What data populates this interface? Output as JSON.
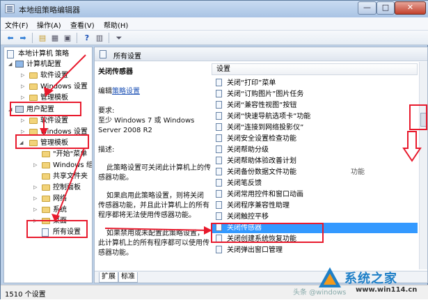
{
  "window": {
    "title": "本地组策略编辑器",
    "min_label": "—",
    "max_label": "□",
    "close_label": "✕"
  },
  "menubar": {
    "items": [
      "文件(F)",
      "操作(A)",
      "查看(V)",
      "帮助(H)"
    ]
  },
  "toolbar": {
    "icons": [
      "back-icon",
      "forward-icon",
      "up-folder-icon",
      "show-tree-icon",
      "export-list-icon",
      "help-icon",
      "properties-icon",
      "filter-icon"
    ]
  },
  "tree": {
    "items": [
      {
        "label": "本地计算机 策略",
        "depth": 0,
        "icon": "computer-policy-icon"
      },
      {
        "label": "计算机配置",
        "depth": 1,
        "icon": "computer-icon"
      },
      {
        "label": "软件设置",
        "depth": 2,
        "icon": "folder-icon"
      },
      {
        "label": "Windows 设置",
        "depth": 2,
        "icon": "folder-icon"
      },
      {
        "label": "管理模板",
        "depth": 2,
        "icon": "folder-icon"
      },
      {
        "label": "用户配置",
        "depth": 1,
        "icon": "user-icon"
      },
      {
        "label": "软件设置",
        "depth": 2,
        "icon": "folder-icon"
      },
      {
        "label": "Windows 设置",
        "depth": 2,
        "icon": "folder-icon"
      },
      {
        "label": "管理模板",
        "depth": 2,
        "icon": "folder-icon"
      },
      {
        "label": "\"开始\"菜单",
        "depth": 3,
        "icon": "folder-icon"
      },
      {
        "label": "Windows 组件",
        "depth": 3,
        "icon": "folder-icon"
      },
      {
        "label": "共享文件夹",
        "depth": 3,
        "icon": "folder-icon"
      },
      {
        "label": "控制面板",
        "depth": 3,
        "icon": "folder-icon"
      },
      {
        "label": "网络",
        "depth": 3,
        "icon": "folder-icon"
      },
      {
        "label": "系统",
        "depth": 3,
        "icon": "folder-icon"
      },
      {
        "label": "桌面",
        "depth": 3,
        "icon": "folder-icon"
      },
      {
        "label": "所有设置",
        "depth": 3,
        "icon": "all-settings-icon"
      }
    ]
  },
  "header": {
    "title": "所有设置"
  },
  "description": {
    "setting_name": "关闭传感器",
    "edit_prefix": "编辑",
    "edit_link": "策略设置",
    "requirements_label": "要求:",
    "requirements_line1": "至少 Windows 7 或 Windows",
    "requirements_line2": "Server 2008 R2",
    "desc_label": "描述:",
    "para1_line1": "此策略设置可关闭此计算机上的传",
    "para1_line2": "感器功能。",
    "para2_line1": "如果启用此策略设置，则将关闭",
    "para2_line2": "传感器功能，并且此计算机上的所有",
    "para2_line3": "程序都将无法使用传感器功能。",
    "para3_line1": "如果禁用或未配置此策略设置，",
    "para3_line2": "此计算机上的所有程序都可以使用传",
    "para3_line3": "感器功能。"
  },
  "list": {
    "column": "设置",
    "items": [
      "关闭“打印”菜单",
      "关闭“订购图片”图片任务",
      "关闭“兼容性视图”按钮",
      "关闭“快速导航选项卡”功能",
      "关闭“连接到网络投影仪”",
      "关闭安全设置检查功能",
      "关闭帮助分级",
      "关闭帮助体验改善计划",
      "关闭备份数据文件功能",
      "关闭笔反馈",
      "关闭常用控件和窗口动画",
      "关闭程序兼容性助理",
      "关闭触控平移",
      "关闭传感器",
      "关闭创建系统恢复功能",
      "关闭弹出窗口管理"
    ],
    "selected_index": 13,
    "partial_suffix": "功能"
  },
  "tabs": {
    "extended": "扩展",
    "standard": "标准"
  },
  "status": {
    "text": "1510 个设置"
  },
  "watermark": {
    "name": "系统之家",
    "url": "www.win114.cn",
    "tail": "头条 @windows"
  },
  "colors": {
    "selection": "#3399ff",
    "annotation": "#e8192c",
    "link": "#1a4fb4"
  }
}
